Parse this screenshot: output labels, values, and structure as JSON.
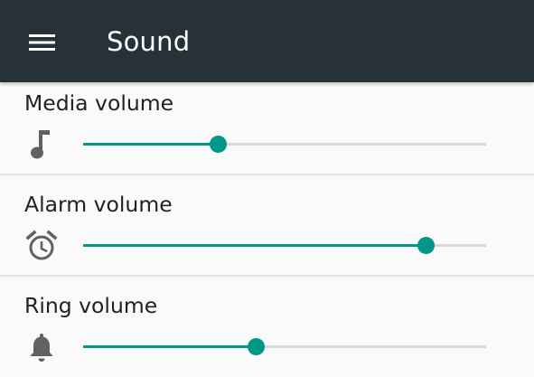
{
  "toolbar": {
    "title": "Sound",
    "menu_icon": "menu-icon",
    "background": "#263238"
  },
  "accent_color": "#009688",
  "volumes": [
    {
      "label": "Media volume",
      "icon": "music-note-icon",
      "level": 0.335
    },
    {
      "label": "Alarm volume",
      "icon": "alarm-clock-icon",
      "level": 0.85
    },
    {
      "label": "Ring volume",
      "icon": "bell-icon",
      "level": 0.43
    }
  ]
}
